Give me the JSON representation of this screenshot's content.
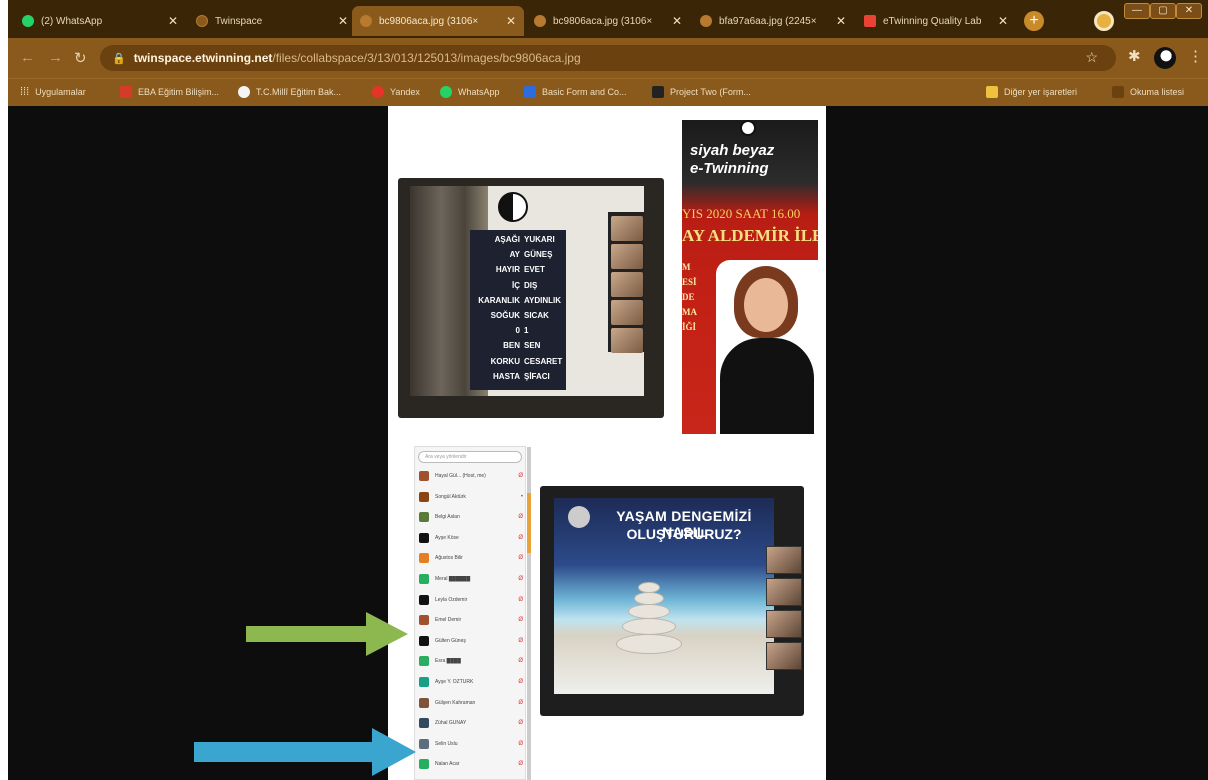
{
  "tabs": [
    {
      "title": "(2) WhatsApp",
      "color": "#25d366"
    },
    {
      "title": "Twinspace",
      "color": "#8a5a1c"
    },
    {
      "title": "bc9806aca.jpg (3106×",
      "color": "#b77a2e",
      "active": true
    },
    {
      "title": "bc9806aca.jpg (3106×",
      "color": "#b77a2e"
    },
    {
      "title": "bfa97a6aa.jpg (2245×",
      "color": "#b77a2e"
    },
    {
      "title": "eTwinning Quality Lab",
      "color": "#ea4335"
    }
  ],
  "toolbar": {
    "url_host": "twinspace.etwinning.net",
    "url_path": "/files/collabspace/3/13/013/125013/images/bc9806aca.jpg"
  },
  "bookmarks": {
    "apps": "Uygulamalar",
    "items": [
      {
        "label": "EBA Eğitim Bilişim...",
        "color": "#d63b2a"
      },
      {
        "label": "T.C.Millî Eğitim Bak...",
        "color": "#e83b3b"
      },
      {
        "label": "Yandex",
        "color": "#e8332a"
      },
      {
        "label": "WhatsApp",
        "color": "#25d366"
      },
      {
        "label": "Basic Form and Co...",
        "color": "#2d6be0"
      },
      {
        "label": "Project Two (Form...",
        "color": "#222222"
      }
    ],
    "other": "Diğer yer işaretleri",
    "reading": "Okuma listesi"
  },
  "slide1": {
    "left_words": [
      "AŞAĞI",
      "AY",
      "HAYIR",
      "İÇ",
      "KARANLIK",
      "SOĞUK",
      "0",
      "BEN",
      "KORKU",
      "HASTA"
    ],
    "right_words": [
      "YUKARI",
      "GÜNEŞ",
      "EVET",
      "DIŞ",
      "AYDINLIK",
      "SICAK",
      "1",
      "SEN",
      "CESARET",
      "ŞİFACI"
    ]
  },
  "poster": {
    "title1": "siyah beyaz",
    "title2": "e-Twinning",
    "date": "YIS 2020 SAAT 16.00",
    "name": "AY ALDEMİR İLE",
    "cut_letters": [
      "M",
      "ESİ",
      "DE",
      "MA",
      "İĞİ"
    ]
  },
  "participants": {
    "search_placeholder": "Ara veya yönlendir",
    "rows": [
      {
        "name": "Hayal Gül... (Host, me)",
        "color": "#a0522d",
        "mic": "Ø"
      },
      {
        "name": "Songül Aktürk",
        "color": "#8b4513",
        "mic": "•"
      },
      {
        "name": "Belgi Aslan",
        "color": "#5a7a3a",
        "mic": "Ø"
      },
      {
        "name": "Ayşe Köse",
        "color": "#111111",
        "mic": "Ø"
      },
      {
        "name": "Ağustos Bilir",
        "color": "#e67e22",
        "mic": "Ø"
      },
      {
        "name": "Meral ██████",
        "color": "#27ae60",
        "mic": "Ø"
      },
      {
        "name": "Leyla Özdemir",
        "color": "#111111",
        "mic": "Ø"
      },
      {
        "name": "Emel Demir",
        "color": "#a0522d",
        "mic": "Ø"
      },
      {
        "name": "Gülten Güneş",
        "color": "#111111",
        "mic": "Ø"
      },
      {
        "name": "Esra ████",
        "color": "#27ae60",
        "mic": "Ø"
      },
      {
        "name": "Ayşe Y. ÖZTÜRK",
        "color": "#16a085",
        "mic": "Ø"
      },
      {
        "name": "Gülşen Kahraman",
        "color": "#7f5539",
        "mic": "Ø"
      },
      {
        "name": "Zühal GÜNAY",
        "color": "#34495e",
        "mic": "Ø"
      },
      {
        "name": "Selin Uslu",
        "color": "#5d6d7e",
        "mic": "Ø"
      },
      {
        "name": "Nalan Acar",
        "color": "#27ae60",
        "mic": "Ø"
      }
    ]
  },
  "slide2": {
    "title1": "YAŞAM DENGEMİZİ NASIL",
    "title2": "OLUŞTURURUZ?"
  },
  "colors": {
    "arrow_green": "#8db84f",
    "arrow_blue": "#3aa6d0"
  }
}
